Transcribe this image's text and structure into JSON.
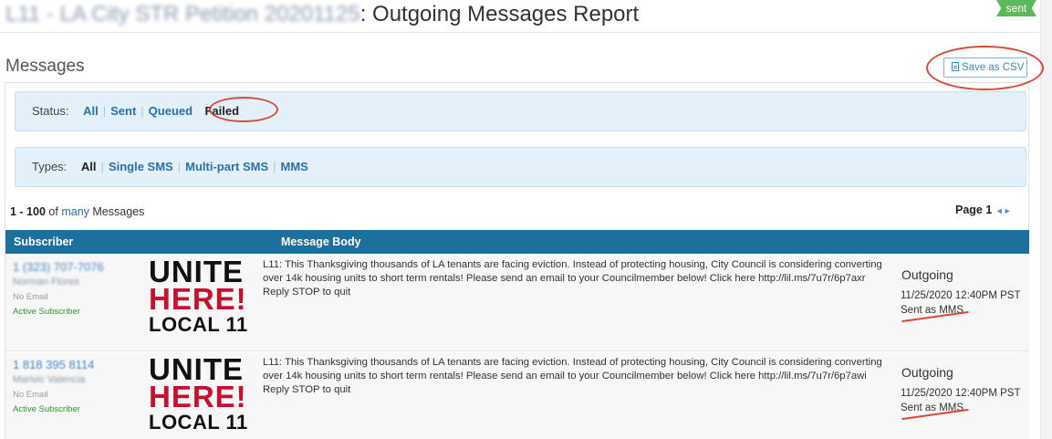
{
  "header": {
    "campaign": "L11 - LA City STR Petition 20201125",
    "title_suffix": ": Outgoing Messages Report",
    "badge": "sent"
  },
  "section": {
    "title": "Messages",
    "csv_label": "Save as CSV"
  },
  "status_filter": {
    "label": "Status:",
    "options": [
      "All",
      "Sent",
      "Queued",
      "Failed"
    ],
    "selected": "Failed"
  },
  "type_filter": {
    "label": "Types:",
    "options": [
      "All",
      "Single SMS",
      "Multi-part SMS",
      "MMS"
    ],
    "selected": "All"
  },
  "summary": {
    "range": "1 - 100",
    "of": "of",
    "many": "many",
    "messages": "Messages",
    "page": "Page 1"
  },
  "table": {
    "columns": [
      "Subscriber",
      "Message Body"
    ],
    "rows": [
      {
        "phone": "1 (323) 707-7076",
        "name": "Norman Flores",
        "email": "No Email",
        "subscriber_status": "Active Subscriber",
        "logo": [
          "UNITE",
          "HERE!",
          "LOCAL 11"
        ],
        "body": "L11: This Thanksgiving thousands of LA tenants are facing eviction. Instead of protecting housing, City Council is considering converting over 14k housing units to short term rentals! Please send an email to your Councilmember below! Click here http://lil.ms/7u7r/6p7axr Reply STOP to quit",
        "direction": "Outgoing",
        "timestamp": "11/25/2020 12:40PM PST",
        "sent_as": "Sent as MMS"
      },
      {
        "phone": "1 818 395 8114",
        "name": "Marivic Valencia",
        "email": "No Email",
        "subscriber_status": "Active Subscriber",
        "logo": [
          "UNITE",
          "HERE!",
          "LOCAL 11"
        ],
        "body": "L11: This Thanksgiving thousands of LA tenants are facing eviction. Instead of protecting housing, City Council is considering converting over 14k housing units to short term rentals! Please send an email to your Councilmember below! Click here http://lil.ms/7u7r/6p7awi Reply STOP to quit",
        "direction": "Outgoing",
        "timestamp": "11/25/2020 12:40PM PST",
        "sent_as": "Sent as MMS"
      }
    ]
  },
  "colors": {
    "table_header": "#1d6f9c",
    "link": "#2a6fac",
    "filter_bg": "#e3f0f9",
    "badge": "#5cb85c",
    "annotation": "#d84a38",
    "logo_red": "#c8102e"
  }
}
